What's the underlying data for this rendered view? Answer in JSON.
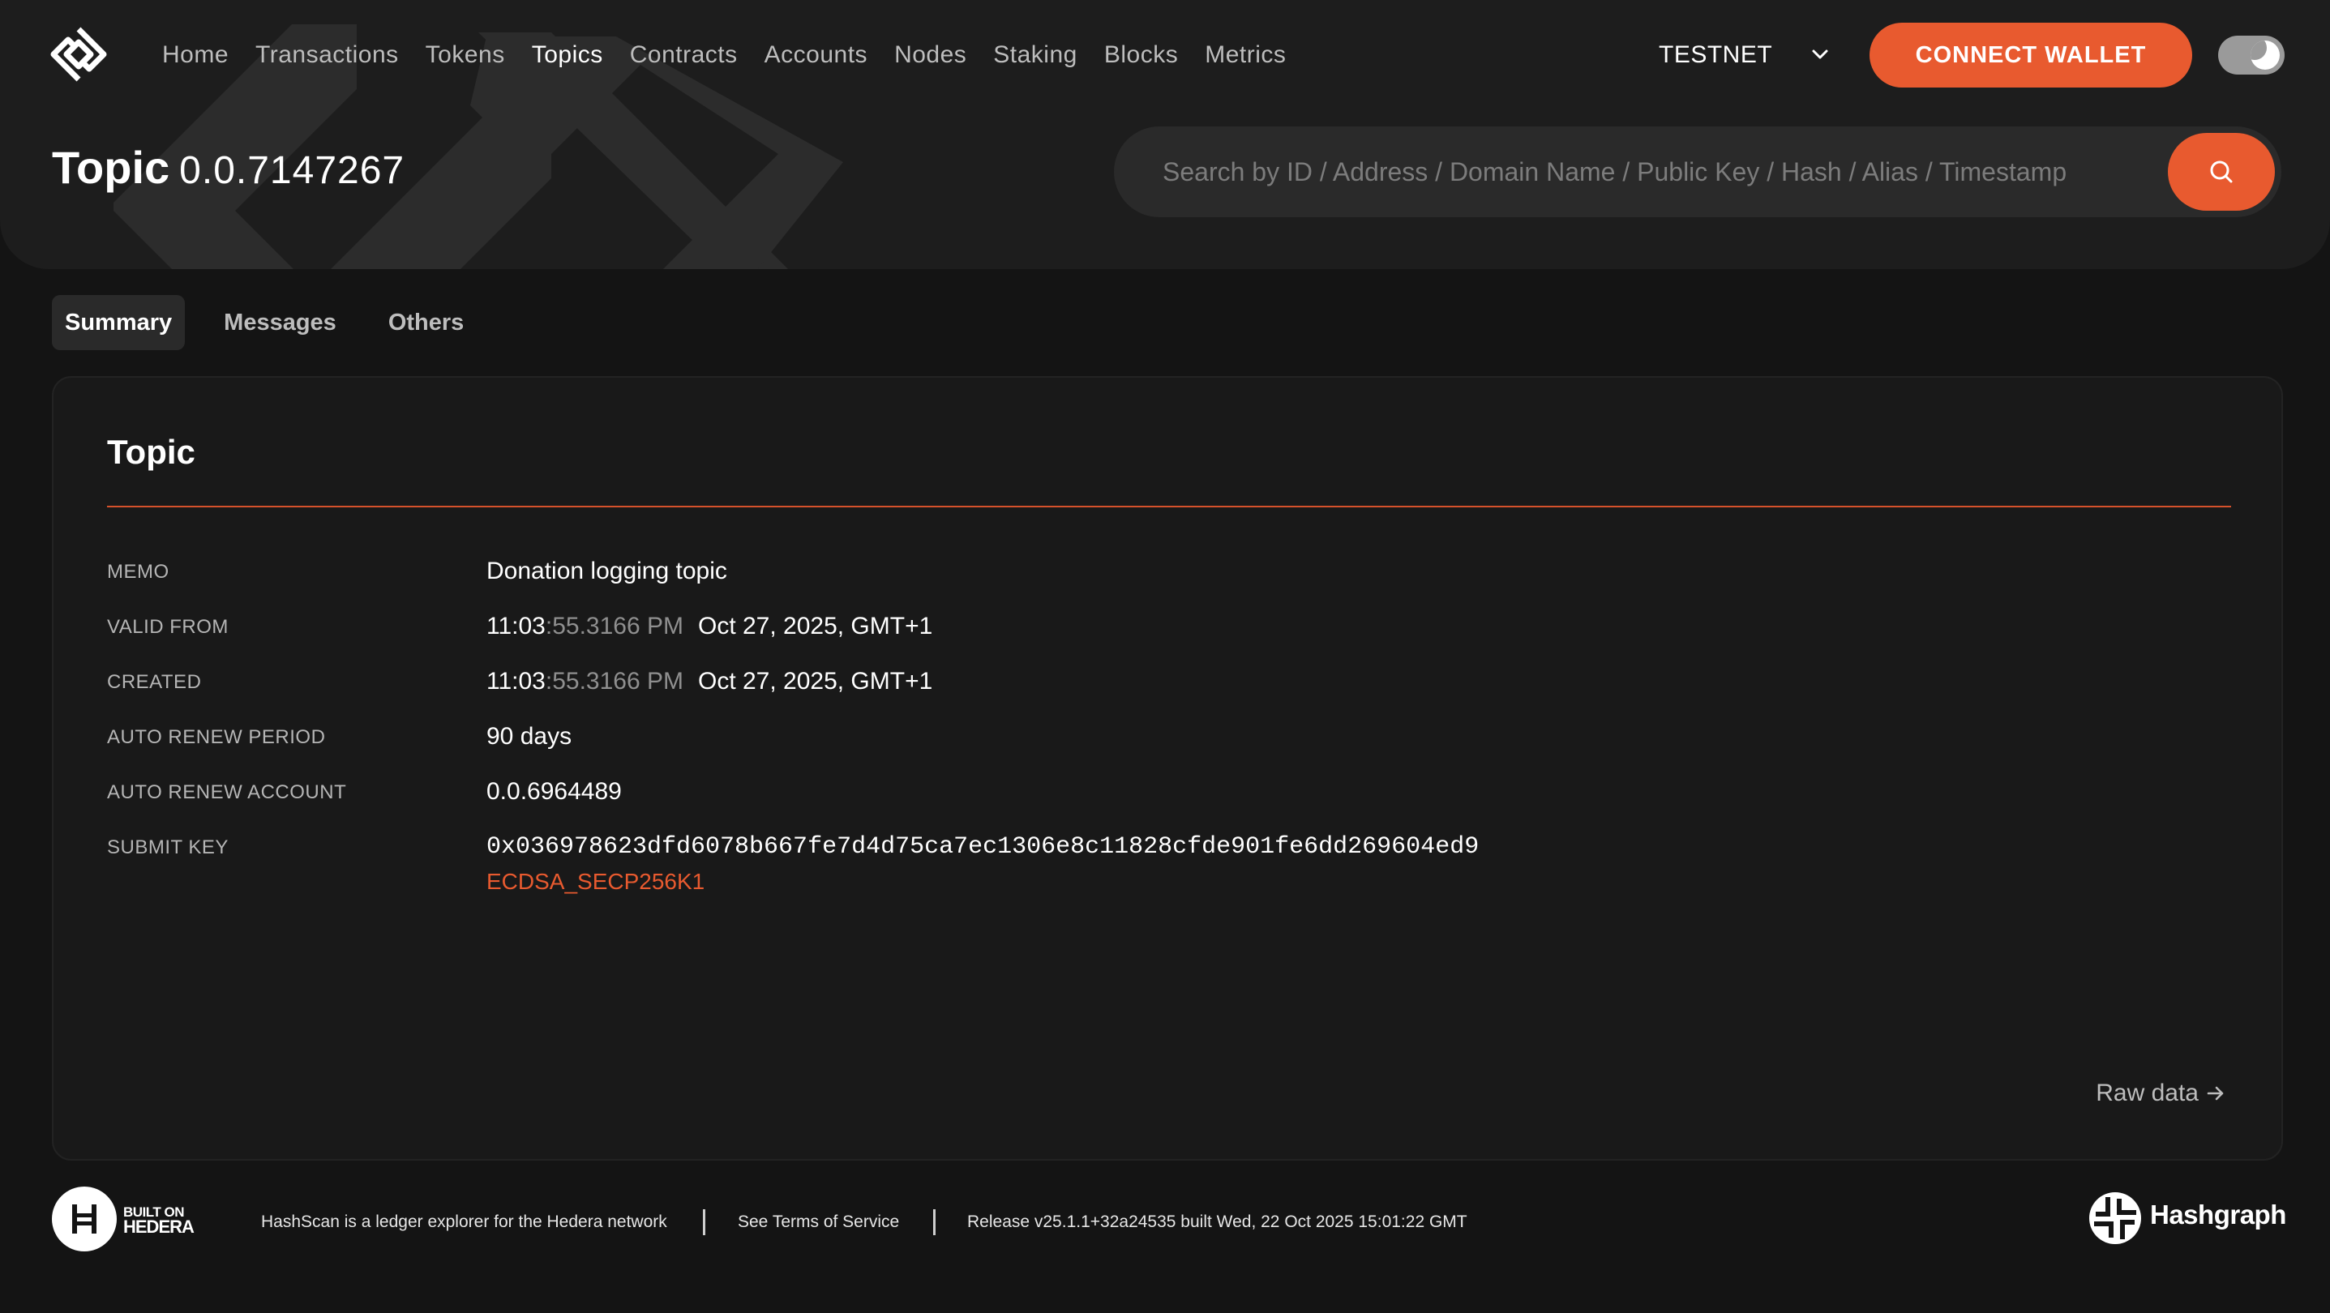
{
  "nav": {
    "items": [
      {
        "label": "Home",
        "active": false
      },
      {
        "label": "Transactions",
        "active": false
      },
      {
        "label": "Tokens",
        "active": false
      },
      {
        "label": "Topics",
        "active": true
      },
      {
        "label": "Contracts",
        "active": false
      },
      {
        "label": "Accounts",
        "active": false
      },
      {
        "label": "Nodes",
        "active": false
      },
      {
        "label": "Staking",
        "active": false
      },
      {
        "label": "Blocks",
        "active": false
      },
      {
        "label": "Metrics",
        "active": false
      }
    ],
    "network": "TESTNET",
    "connect_wallet": "CONNECT WALLET"
  },
  "page": {
    "title": "Topic",
    "topic_id": "0.0.7147267"
  },
  "search": {
    "placeholder": "Search by ID / Address / Domain Name / Public Key / Hash / Alias / Timestamp"
  },
  "tabs": [
    {
      "label": "Summary",
      "active": true
    },
    {
      "label": "Messages",
      "active": false
    },
    {
      "label": "Others",
      "active": false
    }
  ],
  "card": {
    "title": "Topic",
    "memo": {
      "label": "MEMO",
      "value": "Donation logging topic"
    },
    "valid_from": {
      "label": "VALID FROM",
      "time_main": "11:03",
      "time_frac": ":55.3166 PM",
      "date": "Oct 27, 2025, GMT+1"
    },
    "created": {
      "label": "CREATED",
      "time_main": "11:03",
      "time_frac": ":55.3166 PM",
      "date": "Oct 27, 2025, GMT+1"
    },
    "auto_renew_period": {
      "label": "AUTO RENEW PERIOD",
      "value": "90 days"
    },
    "auto_renew_account": {
      "label": "AUTO RENEW ACCOUNT",
      "value": "0.0.6964489"
    },
    "submit_key": {
      "label": "SUBMIT KEY",
      "value": "0x036978623dfd6078b667fe7d4d75ca7ec1306e8c11828cfde901fe6dd269604ed9",
      "key_type": "ECDSA_SECP256K1"
    },
    "raw_data": "Raw data"
  },
  "footer": {
    "built_on_1": "BUILT ON",
    "built_on_2": "HEDERA",
    "description": "HashScan is a ledger explorer for the Hedera network",
    "terms": "See Terms of Service",
    "release": "Release v25.1.1+32a24535 built Wed, 22 Oct 2025 15:01:22 GMT",
    "hashgraph": "Hashgraph"
  },
  "colors": {
    "accent": "#e85a2f",
    "background": "#141414",
    "header_band": "#1d1d1d"
  }
}
